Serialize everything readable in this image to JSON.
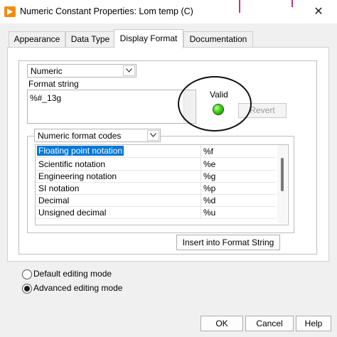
{
  "window": {
    "title": "Numeric Constant Properties: Lom temp (C)",
    "close_glyph": "✕"
  },
  "tabs": [
    {
      "label": "Appearance",
      "active": false
    },
    {
      "label": "Data Type",
      "active": false
    },
    {
      "label": "Display Format",
      "active": true
    },
    {
      "label": "Documentation",
      "active": false
    }
  ],
  "display_format": {
    "type_selected": "Numeric",
    "format_string_label": "Format string",
    "format_string_value": "%#_13g",
    "valid_label": "Valid",
    "valid_color": "#3fcf1f",
    "revert_label": "Revert",
    "codes_dropdown": "Numeric format codes",
    "codes": [
      {
        "name": "Floating point notation",
        "code": "%f",
        "selected": true
      },
      {
        "name": "Scientific notation",
        "code": "%e",
        "selected": false
      },
      {
        "name": "Engineering notation",
        "code": "%g",
        "selected": false
      },
      {
        "name": "SI notation",
        "code": "%p",
        "selected": false
      },
      {
        "name": "Decimal",
        "code": "%d",
        "selected": false
      },
      {
        "name": "Unsigned decimal",
        "code": "%u",
        "selected": false
      }
    ],
    "insert_label": "Insert into Format String"
  },
  "editing_mode": {
    "options": [
      {
        "label": "Default editing mode",
        "checked": false
      },
      {
        "label": "Advanced editing mode",
        "checked": true
      }
    ]
  },
  "footer": {
    "ok_label": "OK",
    "cancel_label": "Cancel",
    "help_label": "Help"
  },
  "colors": {
    "selection": "#0078d7",
    "annotation_circle": "#111111",
    "app_icon": "#f28c0f"
  }
}
